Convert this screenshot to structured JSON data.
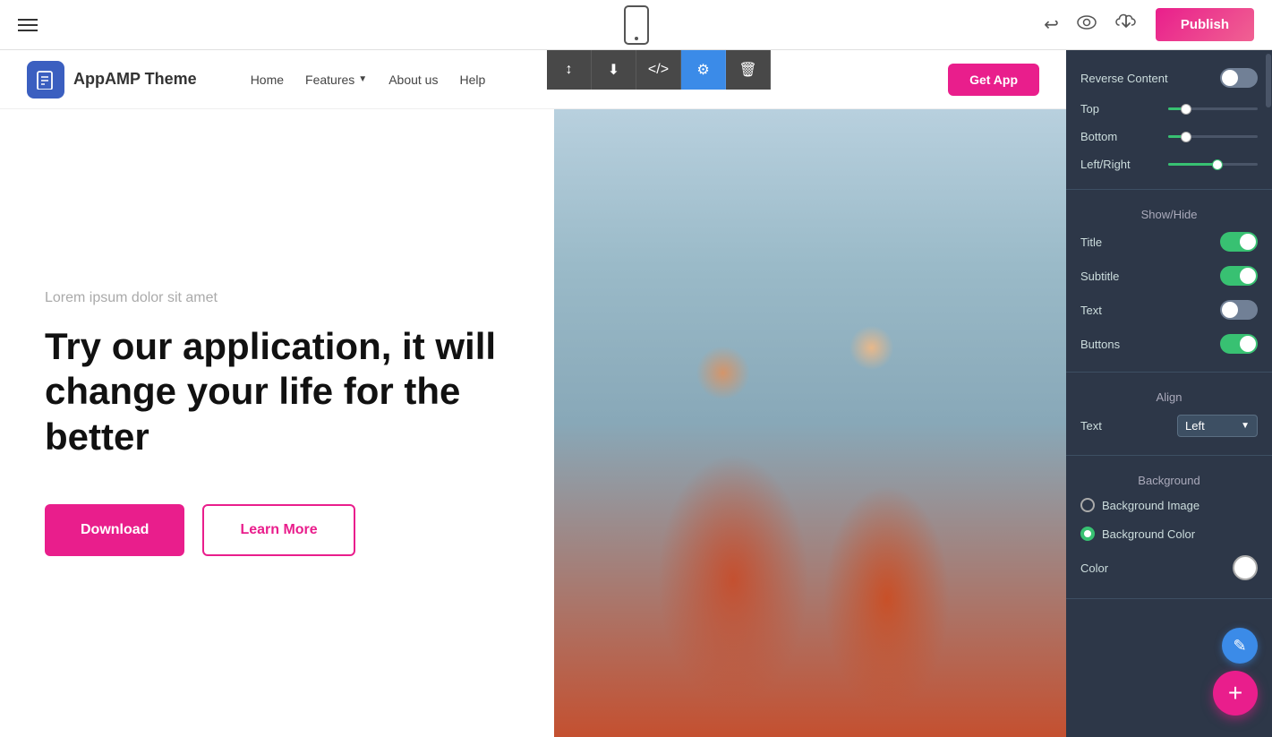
{
  "toolbar": {
    "publish_label": "Publish"
  },
  "nav": {
    "logo_text": "AppAMP Theme",
    "links": [
      "Home",
      "Features",
      "About us",
      "Help"
    ],
    "features_has_dropdown": true,
    "cta_label": "Get App"
  },
  "hero": {
    "subtitle": "Lorem ipsum dolor sit amet",
    "title": "Try our application, it will change your life for the better",
    "btn_download": "Download",
    "btn_learn_more": "Learn More"
  },
  "panel": {
    "reverse_content_label": "Reverse Content",
    "reverse_content_on": false,
    "top_label": "Top",
    "top_value": 20,
    "bottom_label": "Bottom",
    "bottom_value": 20,
    "left_right_label": "Left/Right",
    "left_right_value": 55,
    "show_hide_title": "Show/Hide",
    "title_label": "Title",
    "title_on": true,
    "subtitle_label": "Subtitle",
    "subtitle_on": true,
    "text_label": "Text",
    "text_on": false,
    "buttons_label": "Buttons",
    "buttons_on": true,
    "align_title": "Align",
    "align_text_label": "Text",
    "align_value": "Left",
    "background_title": "Background",
    "bg_image_label": "Background Image",
    "bg_image_selected": false,
    "bg_color_label": "Background Color",
    "bg_color_selected": true,
    "color_label": "Color",
    "color_value": "#ffffff"
  },
  "panel_actions": {
    "sort_icon": "↕",
    "download_icon": "↓",
    "code_icon": "</>",
    "settings_icon": "⚙",
    "delete_icon": "🗑"
  },
  "fab": {
    "add_label": "+",
    "paint_label": "✎"
  }
}
